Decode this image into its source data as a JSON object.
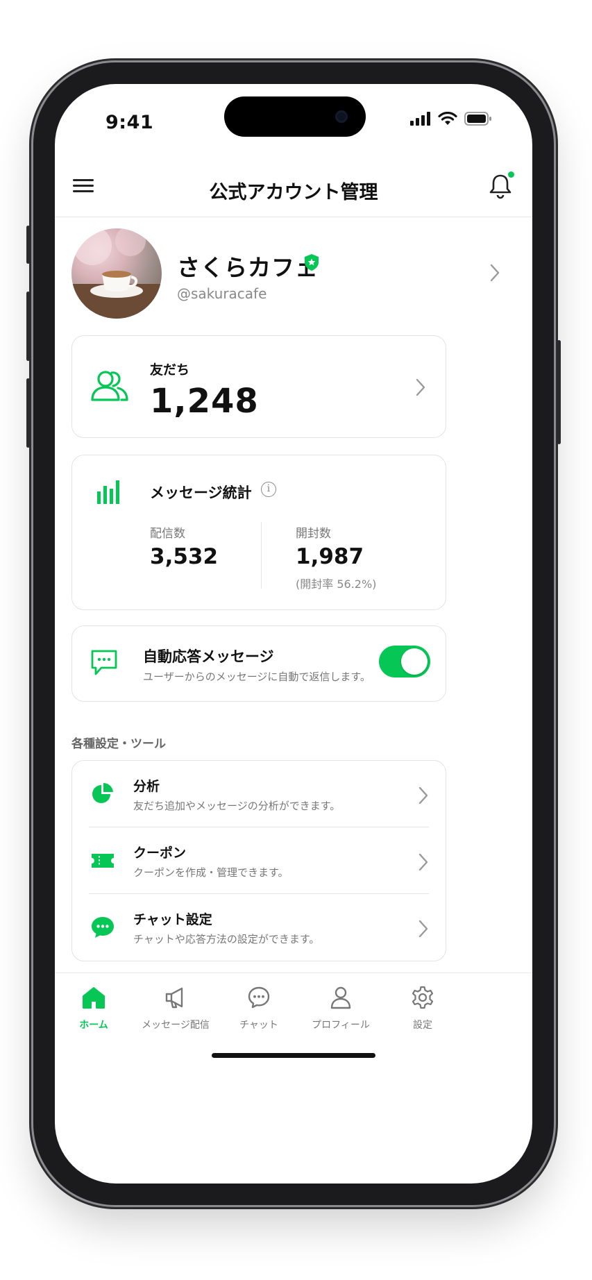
{
  "status_bar": {
    "time": "9:41"
  },
  "header": {
    "title": "公式アカウント管理"
  },
  "profile": {
    "name": "さくらカフェ",
    "id": "@sakuracafe"
  },
  "friends": {
    "label": "友だち",
    "count": "1,248"
  },
  "message_stats": {
    "title": "メッセージ統計",
    "sent": {
      "label": "配信数",
      "value": "3,532"
    },
    "opened": {
      "label": "開封数",
      "value": "1,987",
      "rate_text": "(開封率 56.2%)"
    }
  },
  "auto_reply": {
    "title": "自動応答メッセージ",
    "description": "ユーザーからのメッセージに自動で返信します。",
    "enabled": true
  },
  "tools": {
    "section_label": "各種設定・ツール",
    "items": [
      {
        "title": "分析",
        "description": "友だち追加やメッセージの分析ができます。",
        "icon": "pie-chart-icon"
      },
      {
        "title": "クーポン",
        "description": "クーポンを作成・管理できます。",
        "icon": "ticket-icon"
      },
      {
        "title": "チャット設定",
        "description": "チャットや応答方法の設定ができます。",
        "icon": "chat-bubble-icon"
      }
    ]
  },
  "bottom_nav": {
    "items": [
      {
        "label": "ホーム",
        "icon": "home-icon",
        "active": true
      },
      {
        "label": "メッセージ配信",
        "icon": "megaphone-icon",
        "active": false
      },
      {
        "label": "チャット",
        "icon": "chat-icon",
        "active": false
      },
      {
        "label": "プロフィール",
        "icon": "person-icon",
        "active": false
      },
      {
        "label": "設定",
        "icon": "gear-icon",
        "active": false
      }
    ]
  },
  "colors": {
    "accent": "#06c755",
    "text": "#111111",
    "muted": "#777777"
  }
}
